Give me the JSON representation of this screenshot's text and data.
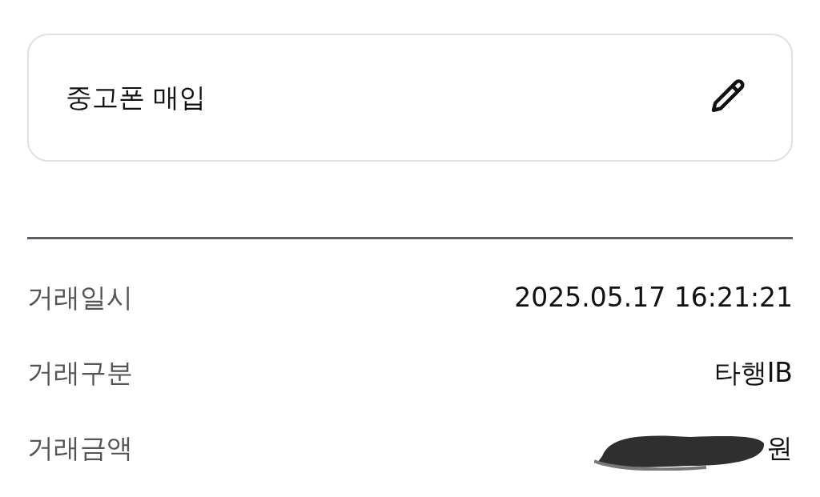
{
  "memo": {
    "text": "중고폰 매입"
  },
  "details": [
    {
      "label": "거래일시",
      "value": "2025.05.17 16:21:21",
      "redacted": false
    },
    {
      "label": "거래구분",
      "value": "타행IB",
      "redacted": false
    },
    {
      "label": "거래금액",
      "value": "원",
      "redacted": true
    }
  ]
}
